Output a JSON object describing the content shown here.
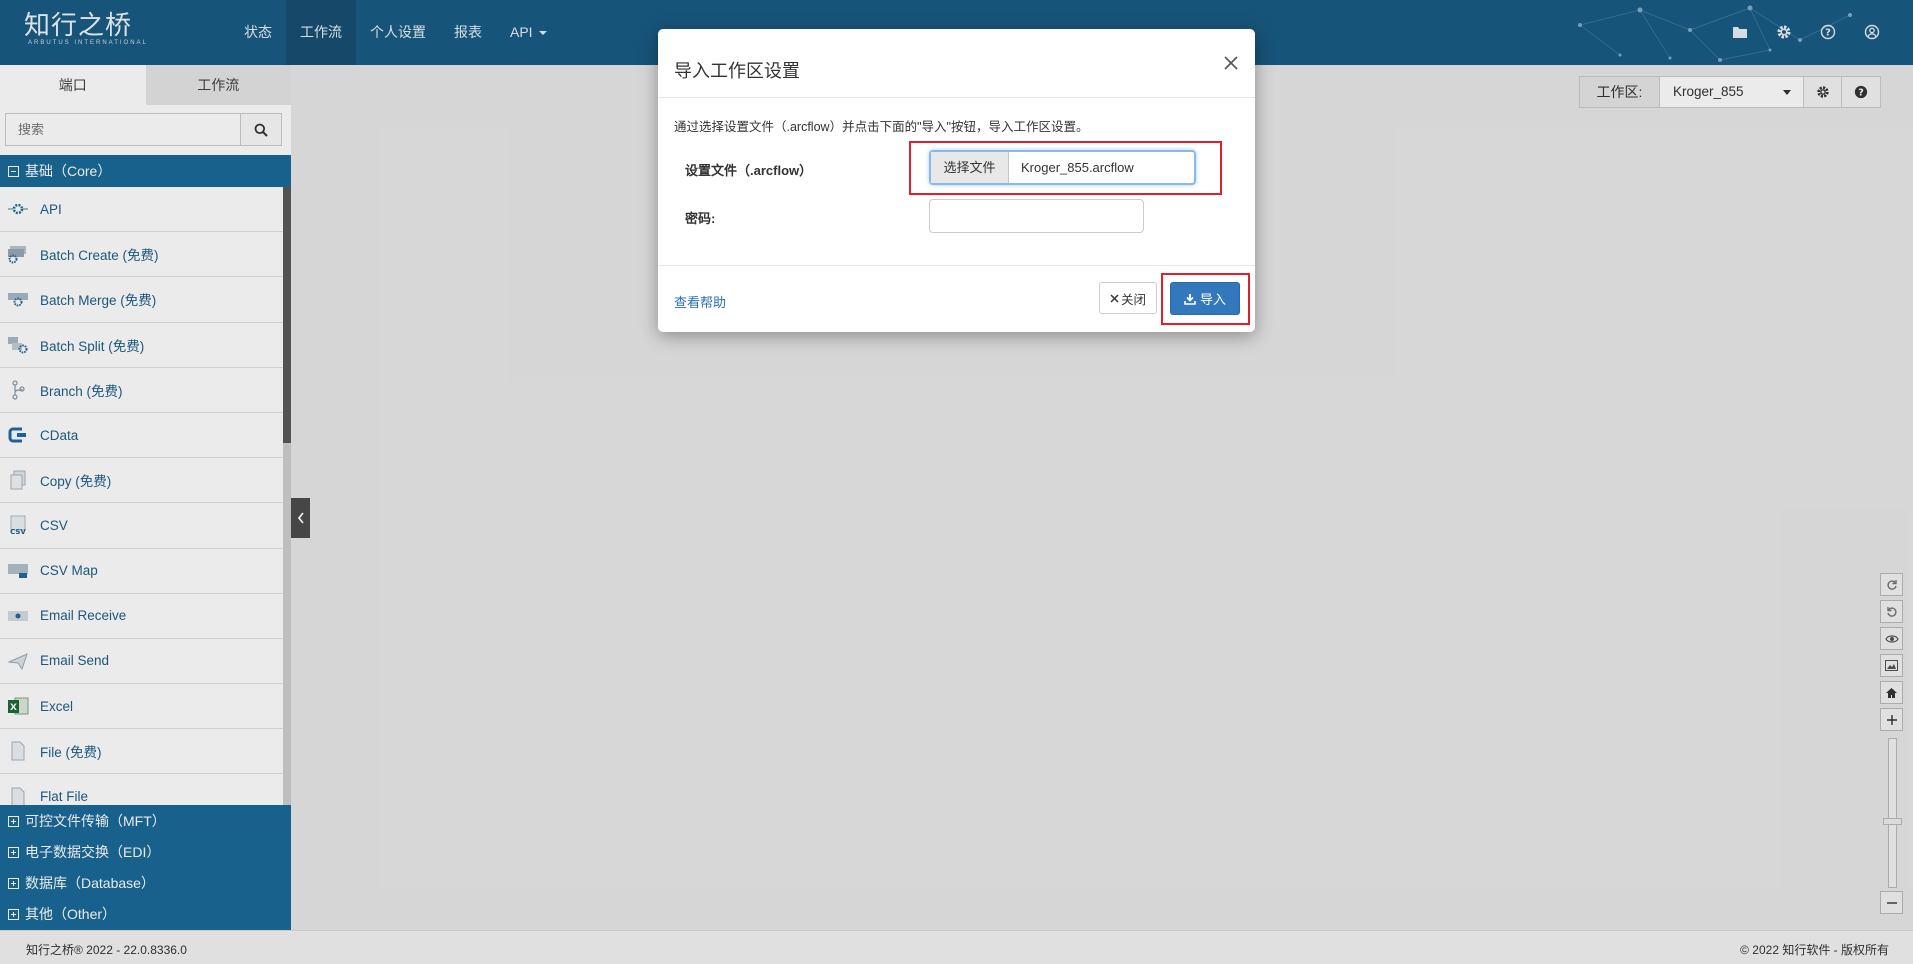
{
  "brand": {
    "name_cn": "知行之桥",
    "name_en": "ARBUTUS INTERNATIONAL"
  },
  "nav": {
    "items": [
      "状态",
      "工作流",
      "个人设置",
      "报表"
    ],
    "api_label": "API",
    "active_index": 1
  },
  "top_icons": [
    "folder-icon",
    "gear-icon",
    "help-circle-icon",
    "user-circle-icon"
  ],
  "sidebar": {
    "tabs": [
      "端口",
      "工作流"
    ],
    "active_tab": 0,
    "search_placeholder": "搜索",
    "core_group": "基础（Core）",
    "core_items": [
      "API",
      "Batch Create (免费)",
      "Batch Merge (免费)",
      "Batch Split (免费)",
      "Branch (免费)",
      "CData",
      "Copy (免费)",
      "CSV",
      "CSV Map",
      "Email Receive",
      "Email Send",
      "Excel",
      "File (免费)",
      "Flat File"
    ],
    "other_groups": [
      "可控文件传输（MFT）",
      "电子数据交换（EDI）",
      "数据库（Database）",
      "其他（Other）"
    ]
  },
  "workspace": {
    "label": "工作区:",
    "selected": "Kroger_855"
  },
  "footer": {
    "left": "知行之桥® 2022 - 22.0.8336.0",
    "right": "© 2022 知行软件 - 版权所有"
  },
  "modal": {
    "title": "导入工作区设置",
    "description": "通过选择设置文件（.arcflow）并点击下面的\"导入\"按钮，导入工作区设置。",
    "file_label": "设置文件（.arcflow）",
    "choose_file_label": "选择文件",
    "file_name": "Kroger_855.arcflow",
    "password_label": "密码:",
    "password_value": "",
    "help_link": "查看帮助",
    "close_label": "关闭",
    "import_label": "导入"
  },
  "colors": {
    "navbar": "#1a5c84",
    "sidebar_group": "#1a6a98",
    "primary_button": "#3378bc",
    "highlight": "#e0202a"
  }
}
